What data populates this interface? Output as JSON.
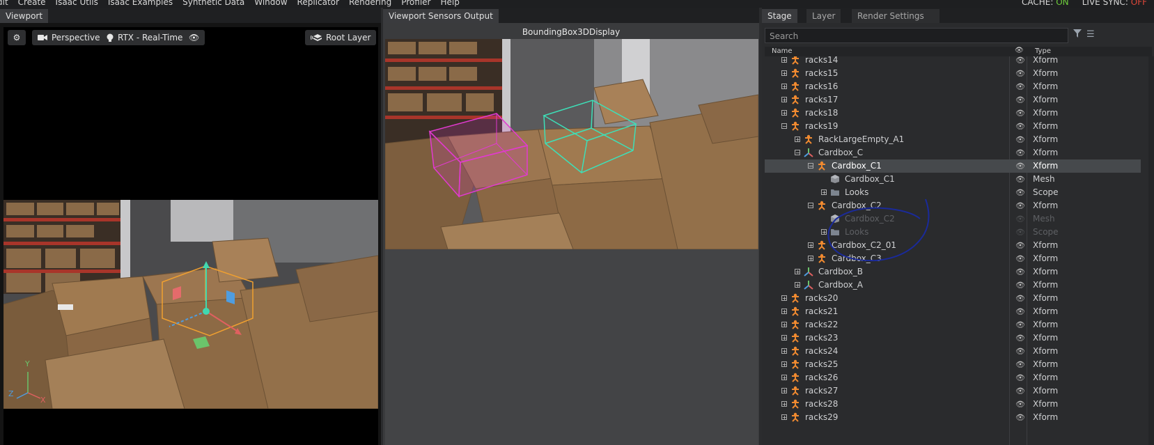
{
  "menubar": {
    "items": [
      "dit",
      "Create",
      "Isaac Utils",
      "Isaac Examples",
      "Synthetic Data",
      "Window",
      "Replicator",
      "Rendering",
      "Profiler",
      "Help"
    ],
    "cache_label": "CACHE:",
    "cache_value": "ON",
    "livesync_label": "LIVE SYNC:",
    "livesync_value": "OFF"
  },
  "viewport": {
    "tab": "Viewport",
    "camera_label": "Perspective",
    "renderer_label": "RTX - Real-Time",
    "layer_label": "Root Layer",
    "axis": {
      "y": "Y",
      "z": "Z",
      "x": "X"
    }
  },
  "sensor": {
    "tab": "Viewport Sensors Output",
    "title": "BoundingBox3DDisplay"
  },
  "stage": {
    "tabs": [
      "Stage",
      "Layer",
      "Render Settings"
    ],
    "search_placeholder": "Search",
    "col_name": "Name",
    "col_type": "Type",
    "rows": [
      {
        "label": "racks14",
        "type": "Xform"
      },
      {
        "label": "racks15",
        "type": "Xform"
      },
      {
        "label": "racks16",
        "type": "Xform"
      },
      {
        "label": "racks17",
        "type": "Xform"
      },
      {
        "label": "racks18",
        "type": "Xform"
      },
      {
        "label": "racks19",
        "type": "Xform"
      },
      {
        "label": "RackLargeEmpty_A1",
        "type": "Xform"
      },
      {
        "label": "Cardbox_C",
        "type": "Xform"
      },
      {
        "label": "Cardbox_C1",
        "type": "Xform"
      },
      {
        "label": "Cardbox_C1",
        "type": "Mesh"
      },
      {
        "label": "Looks",
        "type": "Scope"
      },
      {
        "label": "Cardbox_C2",
        "type": "Xform"
      },
      {
        "label": "Cardbox_C2",
        "type": "Mesh"
      },
      {
        "label": "Looks",
        "type": "Scope"
      },
      {
        "label": "Cardbox_C2_01",
        "type": "Xform"
      },
      {
        "label": "Cardbox_C3",
        "type": "Xform"
      },
      {
        "label": "Cardbox_B",
        "type": "Xform"
      },
      {
        "label": "Cardbox_A",
        "type": "Xform"
      },
      {
        "label": "racks20",
        "type": "Xform"
      },
      {
        "label": "racks21",
        "type": "Xform"
      },
      {
        "label": "racks22",
        "type": "Xform"
      },
      {
        "label": "racks23",
        "type": "Xform"
      },
      {
        "label": "racks24",
        "type": "Xform"
      },
      {
        "label": "racks25",
        "type": "Xform"
      },
      {
        "label": "racks26",
        "type": "Xform"
      },
      {
        "label": "racks27",
        "type": "Xform"
      },
      {
        "label": "racks28",
        "type": "Xform"
      },
      {
        "label": "racks29",
        "type": "Xform"
      }
    ]
  },
  "colors": {
    "accent_on": "#6fcf3c",
    "accent_off": "#e0483a",
    "bbox_magenta": "#e23ad0",
    "bbox_teal": "#3de0b8",
    "gizmo_orange": "#f0a030",
    "annotation_blue": "#1a2a9a"
  }
}
